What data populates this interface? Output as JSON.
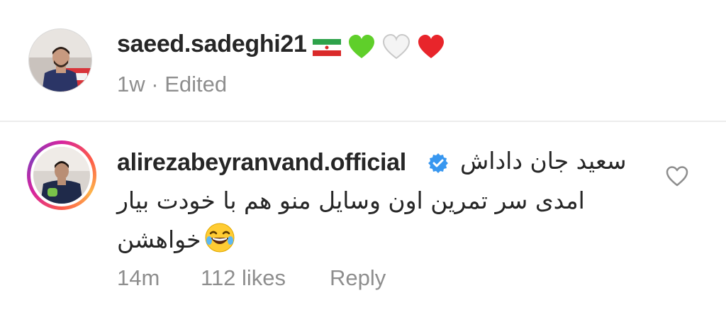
{
  "post": {
    "username": "saeed.sadeghi21",
    "age": "1w",
    "separator": " · ",
    "edited": "Edited",
    "emoji_icons": [
      "iran-flag-icon",
      "green-heart-icon",
      "white-heart-icon",
      "red-heart-icon"
    ]
  },
  "comment": {
    "username": "alirezabeyranvand.official",
    "verified_icon": "verified-badge-icon",
    "text_line1": "سعید جان داداش",
    "text_line2": "امدی سر تمرین اون وسایل منو هم با خودت بیار",
    "text_line3": "خواهشن",
    "emoji_icon": "laughing-emoji-icon",
    "time": "14m",
    "likes": "112 likes",
    "reply": "Reply",
    "like_icon": "heart-outline-icon"
  },
  "colors": {
    "text": "#262626",
    "muted": "#8e8e8e",
    "verified": "#3897f0",
    "divider": "#ececec"
  }
}
